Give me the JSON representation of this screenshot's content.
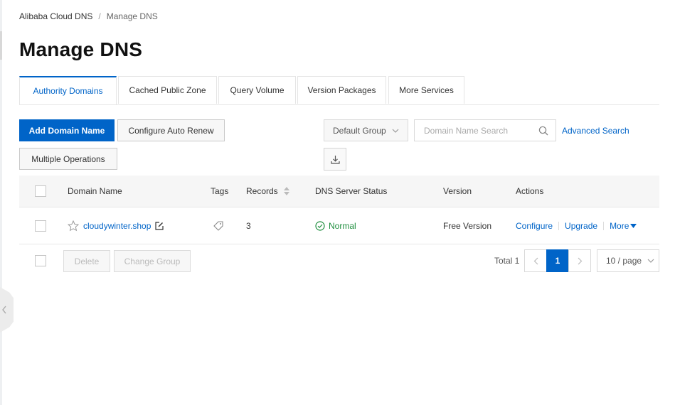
{
  "breadcrumb": {
    "root": "Alibaba Cloud DNS",
    "separator": "/",
    "current": "Manage DNS"
  },
  "page": {
    "title": "Manage DNS"
  },
  "tabs": [
    {
      "label": "Authority Domains",
      "active": true
    },
    {
      "label": "Cached Public Zone",
      "active": false
    },
    {
      "label": "Query Volume",
      "active": false
    },
    {
      "label": "Version Packages",
      "active": false
    },
    {
      "label": "More Services",
      "active": false
    }
  ],
  "toolbar": {
    "add_domain": "Add Domain Name",
    "auto_renew": "Configure Auto Renew",
    "multiple_ops": "Multiple Operations",
    "group_select": "Default Group",
    "search_placeholder": "Domain Name Search",
    "advanced_search": "Advanced Search",
    "export_icon": "download-icon"
  },
  "table": {
    "columns": {
      "domain": "Domain Name",
      "tags": "Tags",
      "records": "Records",
      "status": "DNS Server Status",
      "version": "Version",
      "actions": "Actions"
    },
    "rows": [
      {
        "domain": "cloudywinter.shop",
        "records": "3",
        "status": "Normal",
        "version": "Free Version",
        "actions": {
          "configure": "Configure",
          "upgrade": "Upgrade",
          "more": "More"
        }
      }
    ]
  },
  "footer": {
    "delete": "Delete",
    "change_group": "Change Group",
    "total": "Total 1",
    "current_page": "1",
    "page_size": "10 / page"
  },
  "colors": {
    "primary": "#0064c8",
    "success": "#1e8e3e",
    "header_bg": "#f6f6f6"
  }
}
